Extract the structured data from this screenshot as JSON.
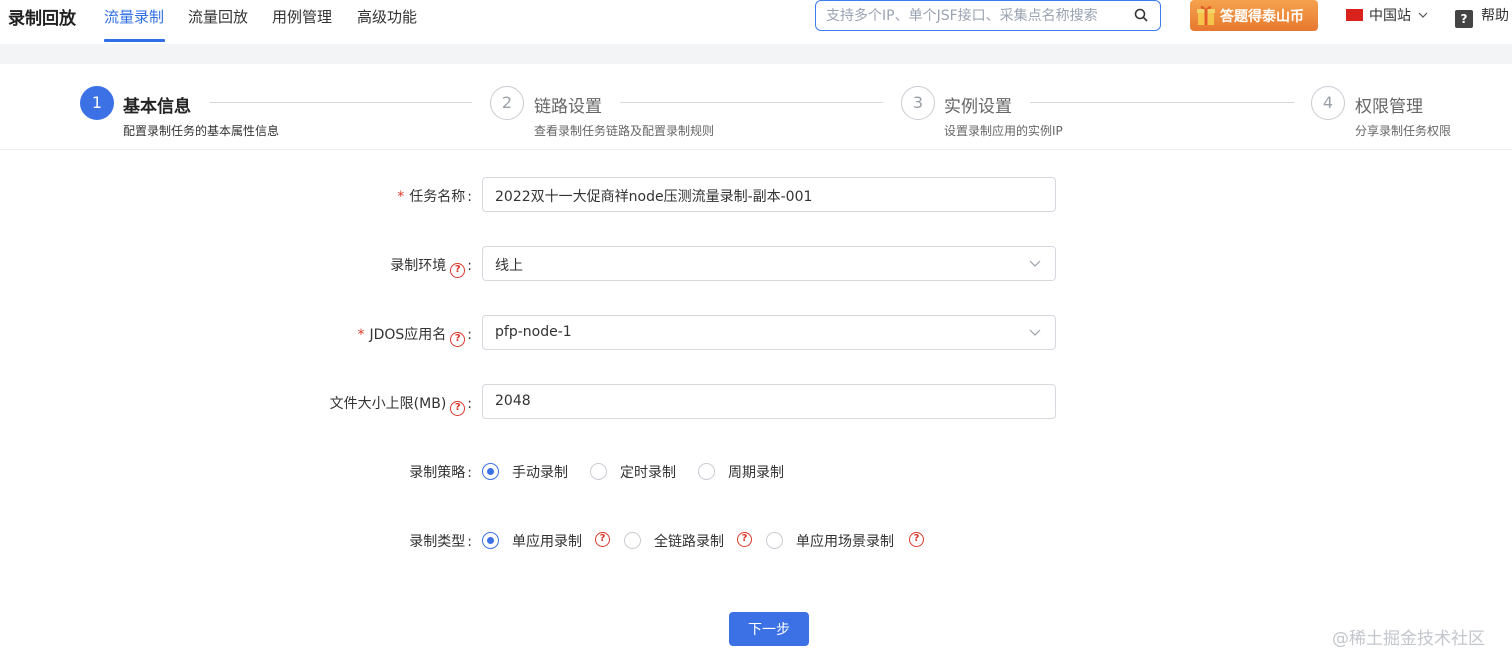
{
  "nav": {
    "brand": "录制回放",
    "items": [
      "流量录制",
      "流量回放",
      "用例管理",
      "高级功能"
    ],
    "active_index": 0,
    "search_placeholder": "支持多个IP、单个JSF接口、采集点名称搜索",
    "promo": "答题得泰山币",
    "region": "中国站",
    "help": "帮助"
  },
  "steps": [
    {
      "num": "1",
      "title": "基本信息",
      "desc": "配置录制任务的基本属性信息"
    },
    {
      "num": "2",
      "title": "链路设置",
      "desc": "查看录制任务链路及配置录制规则"
    },
    {
      "num": "3",
      "title": "实例设置",
      "desc": "设置录制应用的实例IP"
    },
    {
      "num": "4",
      "title": "权限管理",
      "desc": "分享录制任务权限"
    }
  ],
  "form": {
    "task_name": {
      "label": "任务名称",
      "required": true,
      "value": "2022双十一大促商祥node压测流量录制-副本-001"
    },
    "env": {
      "label": "录制环境",
      "value": "线上"
    },
    "jdos": {
      "label": "JDOS应用名",
      "required": true,
      "value": "pfp-node-1"
    },
    "filesize": {
      "label": "文件大小上限(MB)",
      "value": "2048"
    },
    "strategy": {
      "label": "录制策略",
      "options": [
        "手动录制",
        "定时录制",
        "周期录制"
      ],
      "selected": 0
    },
    "rtype": {
      "label": "录制类型",
      "options": [
        "单应用录制",
        "全链路录制",
        "单应用场景录制"
      ],
      "selected": 0
    }
  },
  "next_button": "下一步",
  "watermark": "@稀土掘金技术社区",
  "colors": {
    "primary": "#3c71e6",
    "required": "#e0392a",
    "promo": "#e7782f"
  }
}
